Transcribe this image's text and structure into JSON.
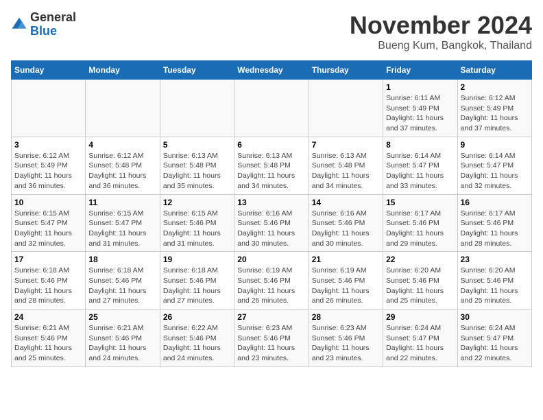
{
  "header": {
    "logo_general": "General",
    "logo_blue": "Blue",
    "month_title": "November 2024",
    "subtitle": "Bueng Kum, Bangkok, Thailand"
  },
  "weekdays": [
    "Sunday",
    "Monday",
    "Tuesday",
    "Wednesday",
    "Thursday",
    "Friday",
    "Saturday"
  ],
  "weeks": [
    [
      {
        "day": "",
        "info": ""
      },
      {
        "day": "",
        "info": ""
      },
      {
        "day": "",
        "info": ""
      },
      {
        "day": "",
        "info": ""
      },
      {
        "day": "",
        "info": ""
      },
      {
        "day": "1",
        "info": "Sunrise: 6:11 AM\nSunset: 5:49 PM\nDaylight: 11 hours\nand 37 minutes."
      },
      {
        "day": "2",
        "info": "Sunrise: 6:12 AM\nSunset: 5:49 PM\nDaylight: 11 hours\nand 37 minutes."
      }
    ],
    [
      {
        "day": "3",
        "info": "Sunrise: 6:12 AM\nSunset: 5:49 PM\nDaylight: 11 hours\nand 36 minutes."
      },
      {
        "day": "4",
        "info": "Sunrise: 6:12 AM\nSunset: 5:48 PM\nDaylight: 11 hours\nand 36 minutes."
      },
      {
        "day": "5",
        "info": "Sunrise: 6:13 AM\nSunset: 5:48 PM\nDaylight: 11 hours\nand 35 minutes."
      },
      {
        "day": "6",
        "info": "Sunrise: 6:13 AM\nSunset: 5:48 PM\nDaylight: 11 hours\nand 34 minutes."
      },
      {
        "day": "7",
        "info": "Sunrise: 6:13 AM\nSunset: 5:48 PM\nDaylight: 11 hours\nand 34 minutes."
      },
      {
        "day": "8",
        "info": "Sunrise: 6:14 AM\nSunset: 5:47 PM\nDaylight: 11 hours\nand 33 minutes."
      },
      {
        "day": "9",
        "info": "Sunrise: 6:14 AM\nSunset: 5:47 PM\nDaylight: 11 hours\nand 32 minutes."
      }
    ],
    [
      {
        "day": "10",
        "info": "Sunrise: 6:15 AM\nSunset: 5:47 PM\nDaylight: 11 hours\nand 32 minutes."
      },
      {
        "day": "11",
        "info": "Sunrise: 6:15 AM\nSunset: 5:47 PM\nDaylight: 11 hours\nand 31 minutes."
      },
      {
        "day": "12",
        "info": "Sunrise: 6:15 AM\nSunset: 5:46 PM\nDaylight: 11 hours\nand 31 minutes."
      },
      {
        "day": "13",
        "info": "Sunrise: 6:16 AM\nSunset: 5:46 PM\nDaylight: 11 hours\nand 30 minutes."
      },
      {
        "day": "14",
        "info": "Sunrise: 6:16 AM\nSunset: 5:46 PM\nDaylight: 11 hours\nand 30 minutes."
      },
      {
        "day": "15",
        "info": "Sunrise: 6:17 AM\nSunset: 5:46 PM\nDaylight: 11 hours\nand 29 minutes."
      },
      {
        "day": "16",
        "info": "Sunrise: 6:17 AM\nSunset: 5:46 PM\nDaylight: 11 hours\nand 28 minutes."
      }
    ],
    [
      {
        "day": "17",
        "info": "Sunrise: 6:18 AM\nSunset: 5:46 PM\nDaylight: 11 hours\nand 28 minutes."
      },
      {
        "day": "18",
        "info": "Sunrise: 6:18 AM\nSunset: 5:46 PM\nDaylight: 11 hours\nand 27 minutes."
      },
      {
        "day": "19",
        "info": "Sunrise: 6:18 AM\nSunset: 5:46 PM\nDaylight: 11 hours\nand 27 minutes."
      },
      {
        "day": "20",
        "info": "Sunrise: 6:19 AM\nSunset: 5:46 PM\nDaylight: 11 hours\nand 26 minutes."
      },
      {
        "day": "21",
        "info": "Sunrise: 6:19 AM\nSunset: 5:46 PM\nDaylight: 11 hours\nand 26 minutes."
      },
      {
        "day": "22",
        "info": "Sunrise: 6:20 AM\nSunset: 5:46 PM\nDaylight: 11 hours\nand 25 minutes."
      },
      {
        "day": "23",
        "info": "Sunrise: 6:20 AM\nSunset: 5:46 PM\nDaylight: 11 hours\nand 25 minutes."
      }
    ],
    [
      {
        "day": "24",
        "info": "Sunrise: 6:21 AM\nSunset: 5:46 PM\nDaylight: 11 hours\nand 25 minutes."
      },
      {
        "day": "25",
        "info": "Sunrise: 6:21 AM\nSunset: 5:46 PM\nDaylight: 11 hours\nand 24 minutes."
      },
      {
        "day": "26",
        "info": "Sunrise: 6:22 AM\nSunset: 5:46 PM\nDaylight: 11 hours\nand 24 minutes."
      },
      {
        "day": "27",
        "info": "Sunrise: 6:23 AM\nSunset: 5:46 PM\nDaylight: 11 hours\nand 23 minutes."
      },
      {
        "day": "28",
        "info": "Sunrise: 6:23 AM\nSunset: 5:46 PM\nDaylight: 11 hours\nand 23 minutes."
      },
      {
        "day": "29",
        "info": "Sunrise: 6:24 AM\nSunset: 5:47 PM\nDaylight: 11 hours\nand 22 minutes."
      },
      {
        "day": "30",
        "info": "Sunrise: 6:24 AM\nSunset: 5:47 PM\nDaylight: 11 hours\nand 22 minutes."
      }
    ]
  ]
}
